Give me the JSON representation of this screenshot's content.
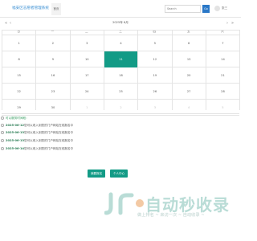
{
  "header": {
    "title": "福安区志愿者管理系统",
    "nav_tab": "首页",
    "search_placeholder": "Search",
    "search_button": "Go",
    "user_name": "张三"
  },
  "calendar": {
    "title": "2025年 6月",
    "prev_year": "«",
    "prev_month": "‹",
    "next_month": "›",
    "next_year": "»",
    "weekdays": [
      "日",
      "一",
      "二",
      "三",
      "四",
      "五",
      "六"
    ],
    "weeks": [
      [
        "1",
        "2",
        "3",
        "4",
        "5",
        "6",
        "7"
      ],
      [
        "8",
        "9",
        "10",
        "11",
        "12",
        "13",
        "14"
      ],
      [
        "15",
        "16",
        "17",
        "18",
        "19",
        "20",
        "21"
      ],
      [
        "22",
        "23",
        "24",
        "25",
        "26",
        "27",
        "28"
      ],
      [
        "29",
        "30",
        "1",
        "2",
        "3",
        "4",
        "5"
      ]
    ],
    "today": "11",
    "accent_color": "#139b86"
  },
  "list": {
    "header": "可以服务时间段：",
    "items": [
      {
        "date": "2025-06-12",
        "text": "您可以收入到您的门户网站在线报名中"
      },
      {
        "date": "2025-06-13",
        "text": "您可以收入到您的门户网站在线报名中"
      },
      {
        "date": "2025-06-13",
        "text": "您可以收入到您的门户网站在线报名中"
      },
      {
        "date": "2025-06-14",
        "text": "您可以收入到您的门户网站在线报名中"
      }
    ]
  },
  "buttons": {
    "primary": "我要报名",
    "secondary": "个人中心"
  },
  "watermark": {
    "big": "自动秒收录",
    "small": "做上排名 ~ 来访一次 ~ 自动收录 ~"
  }
}
